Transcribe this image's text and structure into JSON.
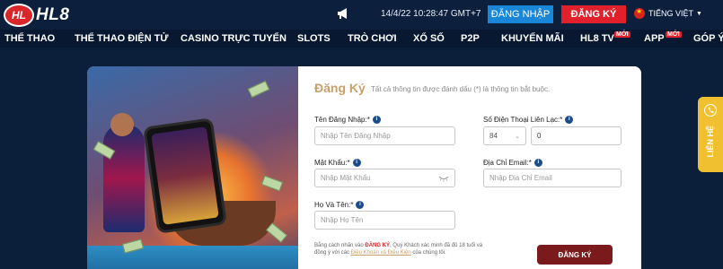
{
  "header": {
    "logo_mark": "HL",
    "logo_text": "HL8",
    "clock": "14/4/22 10:28:47 GMT+7",
    "login_label": "ĐĂNG NHẬP",
    "register_label": "ĐĂNG KÝ",
    "language": "TIẾNG VIỆT"
  },
  "nav": {
    "items": [
      {
        "label": "THỂ THAO"
      },
      {
        "label": "THỂ THAO ĐIỆN TỬ"
      },
      {
        "label": "CASINO TRỰC TUYẾN"
      },
      {
        "label": "SLOTS"
      },
      {
        "label": "TRÒ CHƠI"
      },
      {
        "label": "XỔ SỐ"
      },
      {
        "label": "P2P"
      },
      {
        "label": "KHUYẾN MÃI"
      },
      {
        "label": "HL8 TV"
      },
      {
        "label": "APP"
      },
      {
        "label": "GÓP Ý"
      }
    ],
    "badge_new": "MỚI"
  },
  "form": {
    "title": "Đăng Ký",
    "hint": "Tất cả thông tin được đánh dấu (*) là thông tin bắt buộc.",
    "username_label": "Tên Đăng Nhập:*",
    "username_placeholder": "Nhập Tên Đăng Nhập",
    "phone_label": "Số Điện Thoại Liên Lạc:*",
    "phone_code": "84",
    "phone_value": "0",
    "password_label": "Mật Khẩu:*",
    "password_placeholder": "Nhập Mật Khẩu",
    "email_label": "Địa Chỉ Email:*",
    "email_placeholder": "Nhập Địa Chỉ Email",
    "fullname_label": "Họ Và Tên:*",
    "fullname_placeholder": "Nhập Họ Tên",
    "terms_prefix": "Bằng cách nhấn vào",
    "terms_em": "ĐĂNG KÝ",
    "terms_mid": ", Quý Khách xác minh đã đủ 18 tuổi và đồng ý với các",
    "terms_link": "Điều Khoản và Điều Kiện",
    "terms_suffix": "của chúng tôi.",
    "submit_label": "ĐĂNG KÝ"
  },
  "side": {
    "contact_label": "LIÊN HỆ"
  },
  "colors": {
    "brand_red": "#e0212b",
    "login_blue": "#1a86d8",
    "title_gold": "#c9a06a",
    "submit_maroon": "#7a1a1c",
    "contact_yellow": "#f0c030"
  }
}
